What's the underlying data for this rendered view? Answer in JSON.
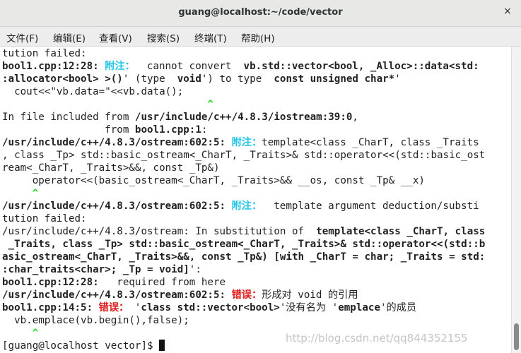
{
  "window": {
    "title": "guang@localhost:~/code/vector",
    "close_symbol": "×"
  },
  "menu": [
    "文件(F)",
    "编辑(E)",
    "查看(V)",
    "搜索(S)",
    "终端(T)",
    "帮助(H)"
  ],
  "colors": {
    "note": "#22c3e8",
    "error": "#e01b1b",
    "caret": "#28d828"
  },
  "terminal_lines": [
    [
      [
        "n",
        "tution failed:"
      ]
    ],
    [
      [
        "b",
        "bool1.cpp:12:28: "
      ],
      [
        "note",
        "附注："
      ],
      [
        "n",
        "  cannot convert  "
      ],
      [
        "b",
        "vb.std::vector<bool, _Alloc>::data<std:"
      ]
    ],
    [
      [
        "b",
        ":allocator<bool> >()"
      ],
      [
        "n",
        "' (type  "
      ],
      [
        "b",
        "void"
      ],
      [
        "n",
        "') to type  "
      ],
      [
        "b",
        "const unsigned char*"
      ],
      [
        "n",
        "'"
      ]
    ],
    [
      [
        "n",
        "  cout<<\"vb.data=\"<<vb.data();"
      ]
    ],
    [
      [
        "n",
        "                                  "
      ],
      [
        "caret",
        "^"
      ]
    ],
    [
      [
        "n",
        "In file included from "
      ],
      [
        "b",
        "/usr/include/c++/4.8.3/iostream:39:0"
      ],
      [
        "n",
        ","
      ]
    ],
    [
      [
        "n",
        "                 from "
      ],
      [
        "b",
        "bool1.cpp:1"
      ],
      [
        "n",
        ":"
      ]
    ],
    [
      [
        "b",
        "/usr/include/c++/4.8.3/ostream:602:5: "
      ],
      [
        "note",
        "附注："
      ],
      [
        "n",
        "template<class _CharT, class _Traits"
      ]
    ],
    [
      [
        "n",
        ", class _Tp> std::basic_ostream<_CharT, _Traits>& std::operator<<(std::basic_ost"
      ]
    ],
    [
      [
        "n",
        "ream<_CharT, _Traits>&&, const _Tp&)"
      ]
    ],
    [
      [
        "n",
        "     operator<<(basic_ostream<_CharT, _Traits>&& __os, const _Tp& __x)"
      ]
    ],
    [
      [
        "n",
        "     "
      ],
      [
        "caret",
        "^"
      ]
    ],
    [
      [
        "b",
        "/usr/include/c++/4.8.3/ostream:602:5: "
      ],
      [
        "note",
        "附注："
      ],
      [
        "n",
        "  template argument deduction/substi"
      ]
    ],
    [
      [
        "n",
        "tution failed:"
      ]
    ],
    [
      [
        "n",
        "/usr/include/c++/4.8.3/ostream: In substitution of  "
      ],
      [
        "b",
        "template<class _CharT, class"
      ]
    ],
    [
      [
        "b",
        " _Traits, class _Tp> std::basic_ostream<_CharT, _Traits>& std::operator<<(std::b"
      ]
    ],
    [
      [
        "b",
        "asic_ostream<_CharT, _Traits>&&, const _Tp&) [with _CharT = char; _Traits = std:"
      ]
    ],
    [
      [
        "b",
        ":char_traits<char>; _Tp = void]"
      ],
      [
        "n",
        "':"
      ]
    ],
    [
      [
        "b",
        "bool1.cpp:12:28:"
      ],
      [
        "n",
        "   required from here"
      ]
    ],
    [
      [
        "b",
        "/usr/include/c++/4.8.3/ostream:602:5: "
      ],
      [
        "err",
        "错误："
      ],
      [
        "n",
        "形成对 void 的引用"
      ]
    ],
    [
      [
        "b",
        "bool1.cpp:14:5: "
      ],
      [
        "err",
        "错误："
      ],
      [
        "n",
        " '"
      ],
      [
        "b",
        "class std::vector<bool>"
      ],
      [
        "n",
        "'没有名为 '"
      ],
      [
        "b",
        "emplace"
      ],
      [
        "n",
        "'的成员"
      ]
    ],
    [
      [
        "n",
        "  vb.emplace(vb.begin(),false);"
      ]
    ],
    [
      [
        "n",
        "     "
      ],
      [
        "caret",
        "^"
      ]
    ],
    [
      [
        "n",
        "[guang@localhost vector]$ "
      ],
      [
        "cursor",
        ""
      ]
    ]
  ],
  "watermark": "http://blog.csdn.net/qq844352155"
}
